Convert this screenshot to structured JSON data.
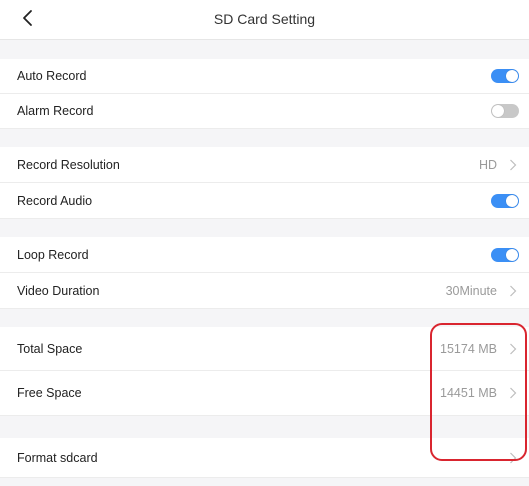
{
  "header": {
    "title": "SD Card Setting"
  },
  "settings": {
    "auto_record": {
      "label": "Auto Record",
      "enabled": true
    },
    "alarm_record": {
      "label": "Alarm Record",
      "enabled": false
    },
    "record_resolution": {
      "label": "Record Resolution",
      "value": "HD"
    },
    "record_audio": {
      "label": "Record Audio",
      "enabled": true
    },
    "loop_record": {
      "label": "Loop Record",
      "enabled": true
    },
    "video_duration": {
      "label": "Video Duration",
      "value": "30Minute"
    },
    "total_space": {
      "label": "Total Space",
      "value": "15174 MB"
    },
    "free_space": {
      "label": "Free Space",
      "value": "14451 MB"
    },
    "format_sdcard": {
      "label": "Format sdcard"
    }
  },
  "colors": {
    "toggle_on": "#3b8ff5",
    "toggle_off": "#c8c8c8",
    "highlight": "#d9252f"
  },
  "icons": {
    "back": "chevron-left-icon",
    "disclosure": "chevron-right-icon"
  }
}
